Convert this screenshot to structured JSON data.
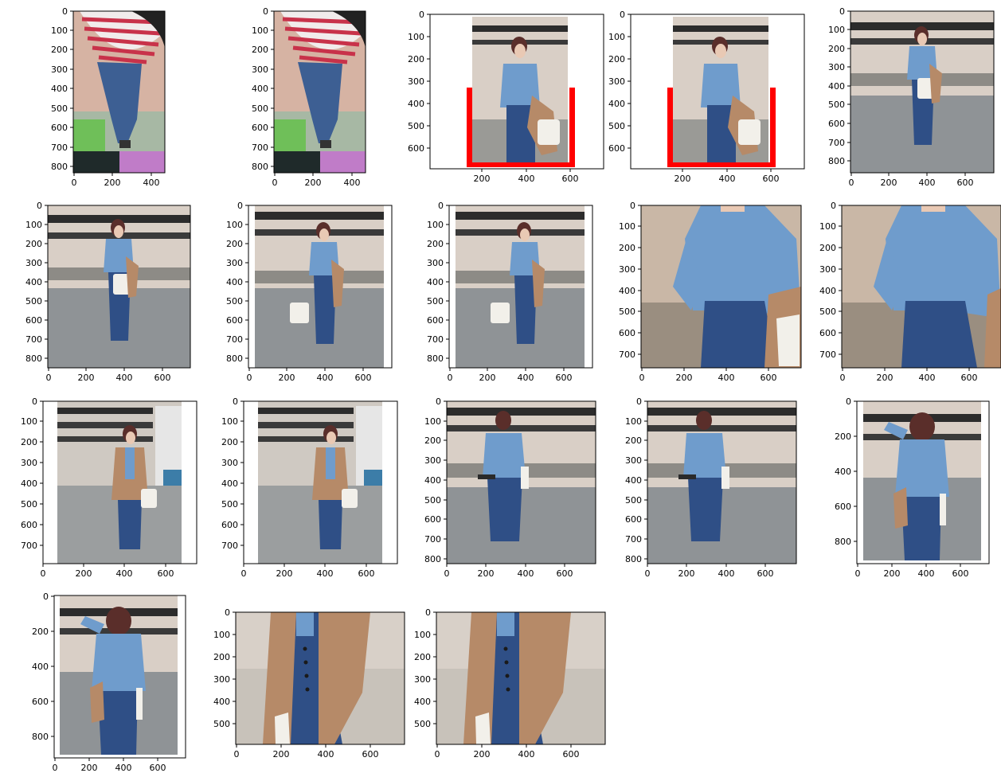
{
  "figure": {
    "panels": [
      {
        "id": "p1",
        "frame": "full",
        "x_ticks": [
          "0",
          "200",
          "400"
        ],
        "y_ticks": [
          "0",
          "100",
          "200",
          "300",
          "400",
          "500",
          "600",
          "700",
          "800"
        ]
      },
      {
        "id": "p2",
        "frame": "full",
        "x_ticks": [
          "0",
          "200",
          "400"
        ],
        "y_ticks": [
          "0",
          "100",
          "200",
          "300",
          "400",
          "500",
          "600",
          "700",
          "800"
        ]
      },
      {
        "id": "p3",
        "frame": "full",
        "x_ticks": [
          "200",
          "400",
          "600"
        ],
        "y_ticks": [
          "0",
          "100",
          "200",
          "300",
          "400",
          "500",
          "600"
        ],
        "bracket_color": "#ff0000"
      },
      {
        "id": "p4",
        "frame": "full",
        "x_ticks": [
          "200",
          "400",
          "600"
        ],
        "y_ticks": [
          "0",
          "100",
          "200",
          "300",
          "400",
          "500",
          "600"
        ],
        "bracket_color": "#ff0000"
      },
      {
        "id": "p5",
        "frame": "full",
        "x_ticks": [
          "0",
          "200",
          "400",
          "600"
        ],
        "y_ticks": [
          "0",
          "100",
          "200",
          "300",
          "400",
          "500",
          "600",
          "700",
          "800"
        ]
      },
      {
        "id": "p6",
        "frame": "full",
        "x_ticks": [
          "0",
          "200",
          "400",
          "600"
        ],
        "y_ticks": [
          "0",
          "100",
          "200",
          "300",
          "400",
          "500",
          "600",
          "700",
          "800"
        ]
      },
      {
        "id": "p7",
        "frame": "full",
        "x_ticks": [
          "0",
          "200",
          "400",
          "600"
        ],
        "y_ticks": [
          "0",
          "100",
          "200",
          "300",
          "400",
          "500",
          "600",
          "700",
          "800"
        ]
      },
      {
        "id": "p8",
        "frame": "full",
        "x_ticks": [
          "0",
          "200",
          "400",
          "600"
        ],
        "y_ticks": [
          "0",
          "100",
          "200",
          "300",
          "400",
          "500",
          "600",
          "700",
          "800"
        ]
      },
      {
        "id": "p9",
        "frame": "full",
        "x_ticks": [
          "0",
          "200",
          "400",
          "600"
        ],
        "y_ticks": [
          "0",
          "100",
          "200",
          "300",
          "400",
          "500",
          "600",
          "700"
        ]
      },
      {
        "id": "p10",
        "frame": "full",
        "x_ticks": [
          "0",
          "200",
          "400",
          "600"
        ],
        "y_ticks": [
          "0",
          "100",
          "200",
          "300",
          "400",
          "500",
          "600",
          "700"
        ]
      },
      {
        "id": "p11",
        "frame": "full",
        "x_ticks": [
          "0",
          "200",
          "400",
          "600"
        ],
        "y_ticks": [
          "0",
          "100",
          "200",
          "300",
          "400",
          "500",
          "600",
          "700"
        ]
      },
      {
        "id": "p12",
        "frame": "full",
        "x_ticks": [
          "0",
          "200",
          "400",
          "600"
        ],
        "y_ticks": [
          "0",
          "100",
          "200",
          "300",
          "400",
          "500",
          "600",
          "700"
        ]
      },
      {
        "id": "p13",
        "frame": "full",
        "x_ticks": [
          "0",
          "200",
          "400",
          "600"
        ],
        "y_ticks": [
          "0",
          "100",
          "200",
          "300",
          "400",
          "500",
          "600",
          "700",
          "800"
        ]
      },
      {
        "id": "p14",
        "frame": "full",
        "x_ticks": [
          "0",
          "200",
          "400",
          "600"
        ],
        "y_ticks": [
          "0",
          "100",
          "200",
          "300",
          "400",
          "500",
          "600",
          "700",
          "800"
        ]
      },
      {
        "id": "p15",
        "frame": "full",
        "x_ticks": [
          "0",
          "200",
          "400",
          "600"
        ],
        "y_ticks": [
          "0",
          "200",
          "400",
          "600",
          "800"
        ]
      },
      {
        "id": "p16",
        "frame": "full",
        "x_ticks": [
          "0",
          "200",
          "400",
          "600"
        ],
        "y_ticks": [
          "0",
          "200",
          "400",
          "600",
          "800"
        ]
      },
      {
        "id": "p17",
        "frame": "full",
        "x_ticks": [
          "0",
          "200",
          "400",
          "600"
        ],
        "y_ticks": [
          "0",
          "100",
          "200",
          "300",
          "400",
          "500"
        ]
      },
      {
        "id": "p18",
        "frame": "full",
        "x_ticks": [
          "0",
          "200",
          "400",
          "600"
        ],
        "y_ticks": [
          "0",
          "100",
          "200",
          "300",
          "400",
          "500"
        ]
      }
    ],
    "colors": {
      "shirt": "#6f9ccc",
      "jeans": "#2f4f86",
      "coat": "#b68a68",
      "hair": "#5a2e2a",
      "wall": "#d9cfc6",
      "floor": "#8f9396",
      "beam": "#2c2c2c",
      "bag": "#f2f0ea",
      "stripe_red": "#c8324a"
    }
  }
}
